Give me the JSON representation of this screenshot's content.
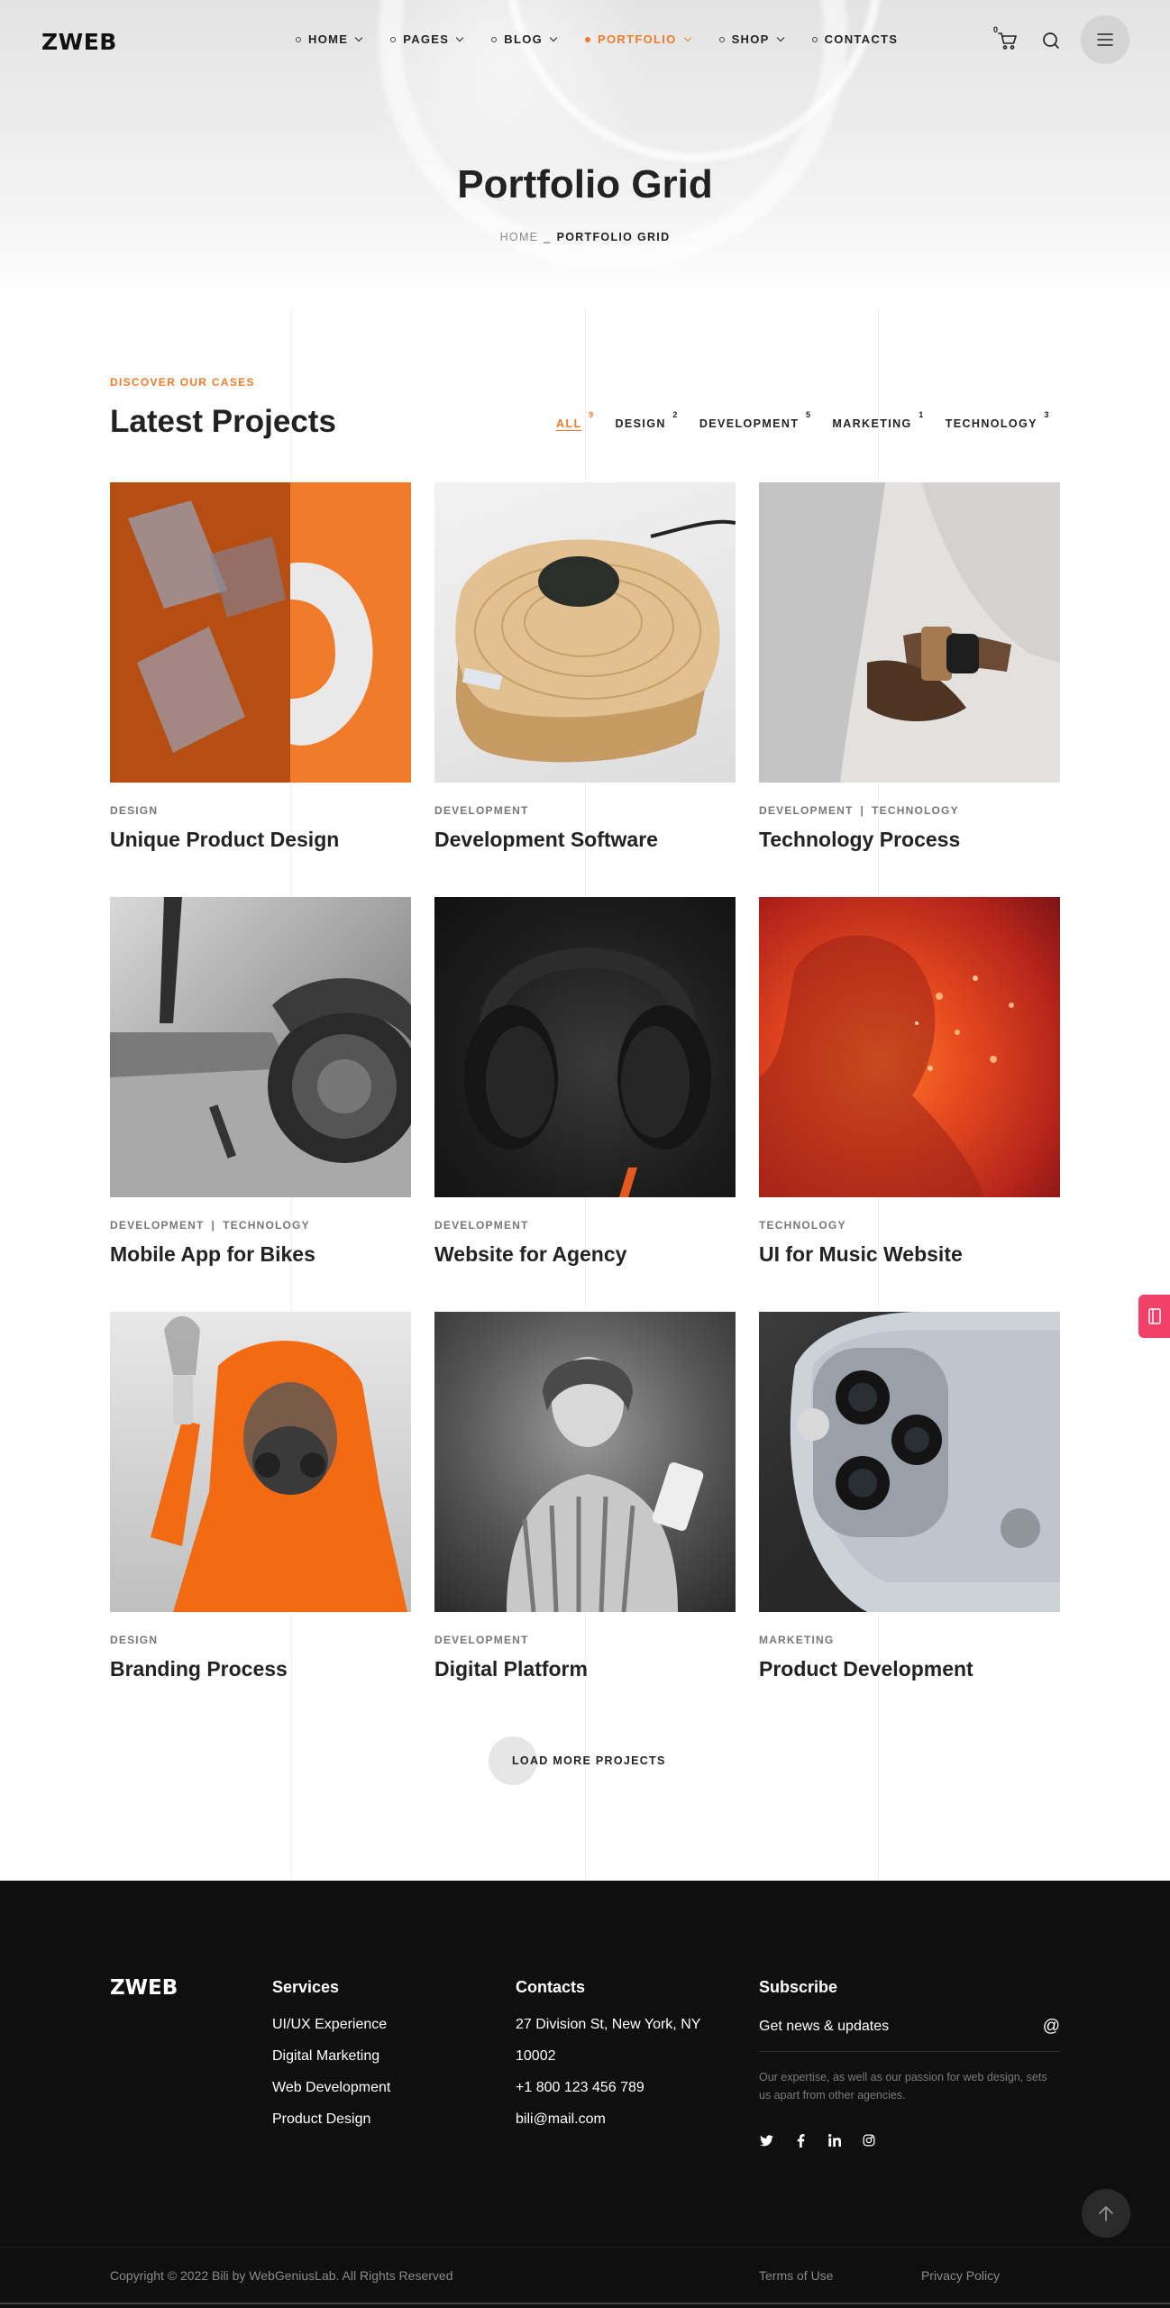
{
  "brand": {
    "logo": "ZWEB"
  },
  "nav": {
    "items": [
      {
        "label": "HOME",
        "has_dropdown": true,
        "active": false
      },
      {
        "label": "PAGES",
        "has_dropdown": true,
        "active": false
      },
      {
        "label": "BLOG",
        "has_dropdown": true,
        "active": false
      },
      {
        "label": "PORTFOLIO",
        "has_dropdown": true,
        "active": true
      },
      {
        "label": "SHOP",
        "has_dropdown": true,
        "active": false
      },
      {
        "label": "CONTACTS",
        "has_dropdown": false,
        "active": false
      }
    ],
    "cart_count": "0",
    "icons": [
      "cart-icon",
      "search-icon",
      "menu-icon"
    ]
  },
  "hero": {
    "title": "Portfolio Grid",
    "breadcrumb": {
      "home": "HOME",
      "separator": "_",
      "current": "PORTFOLIO GRID"
    }
  },
  "projects": {
    "eyebrow": "DISCOVER OUR CASES",
    "title": "Latest Projects",
    "filters": [
      {
        "label": "ALL",
        "count": "9",
        "active": true
      },
      {
        "label": "DESIGN",
        "count": "2",
        "active": false
      },
      {
        "label": "DEVELOPMENT",
        "count": "5",
        "active": false
      },
      {
        "label": "MARKETING",
        "count": "1",
        "active": false
      },
      {
        "label": "TECHNOLOGY",
        "count": "3",
        "active": false
      }
    ],
    "items": [
      {
        "categories": [
          "DESIGN"
        ],
        "title": "Unique Product Design"
      },
      {
        "categories": [
          "DEVELOPMENT"
        ],
        "title": "Development Software"
      },
      {
        "categories": [
          "DEVELOPMENT",
          "TECHNOLOGY"
        ],
        "title": "Technology Process"
      },
      {
        "categories": [
          "DEVELOPMENT",
          "TECHNOLOGY"
        ],
        "title": "Mobile App for Bikes"
      },
      {
        "categories": [
          "DEVELOPMENT"
        ],
        "title": "Website for Agency"
      },
      {
        "categories": [
          "TECHNOLOGY"
        ],
        "title": "UI for Music Website"
      },
      {
        "categories": [
          "DESIGN"
        ],
        "title": "Branding Process"
      },
      {
        "categories": [
          "DEVELOPMENT"
        ],
        "title": "Digital Platform"
      },
      {
        "categories": [
          "MARKETING"
        ],
        "title": "Product Development"
      }
    ],
    "load_more": "LOAD MORE PROJECTS"
  },
  "footer": {
    "logo": "ZWEB",
    "services": {
      "heading": "Services",
      "links": [
        "UI/UX Experience",
        "Digital Marketing",
        "Web Development",
        "Product Design"
      ]
    },
    "contacts": {
      "heading": "Contacts",
      "address_line1": "27 Division St, New York, NY",
      "address_line2": "10002",
      "phone": "+1 800 123 456 789",
      "email": "bili@mail.com"
    },
    "subscribe": {
      "heading": "Subscribe",
      "placeholder": "Get news & updates",
      "submit_symbol": "@",
      "note": "Our expertise, as well as our passion for web design, sets us apart from other agencies.",
      "socials": [
        "twitter-icon",
        "facebook-icon",
        "linkedin-icon",
        "instagram-icon"
      ]
    },
    "copyright": "Copyright © 2022 Bili by WebGeniusLab. All Rights Reserved",
    "terms": "Terms of Use",
    "privacy": "Privacy Policy"
  },
  "colors": {
    "accent": "#f07b2a",
    "footer_bg": "#0f0f0f",
    "side_badge": "#f0416a"
  }
}
